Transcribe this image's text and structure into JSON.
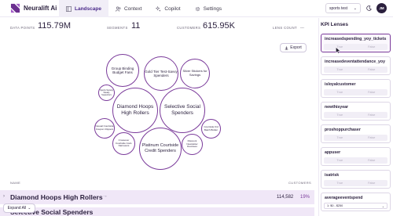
{
  "brand": {
    "name": "Neuralift Ai"
  },
  "nav": {
    "items": [
      {
        "label": "Landscape",
        "icon": "landscape-icon",
        "active": true
      },
      {
        "label": "Context",
        "icon": "people-icon",
        "active": false
      },
      {
        "label": "Copilot",
        "icon": "copilot-sparkle-icon",
        "active": false
      },
      {
        "label": "Settings",
        "icon": "gear-icon",
        "active": false
      }
    ]
  },
  "header": {
    "tenant": "sports test",
    "avatar_initials": "JM"
  },
  "stats": {
    "data_points_label": "DATA POINTS",
    "data_points_value": "115.79M",
    "segments_label": "SEGMENTS",
    "segments_value": "11",
    "customers_label": "CUSTOMERS",
    "customers_value": "615.95K",
    "lens_count_label": "LENS COUNT",
    "lens_count_value": "---"
  },
  "toolbar": {
    "export_label": "Export"
  },
  "segments": [
    {
      "label": "Group Binding Budget Fans"
    },
    {
      "label": "Gold Tier Test-Savvy Spenders"
    },
    {
      "label": "Silver Stickers for Savings"
    },
    {
      "label": "Sports Society Steady Supporters"
    },
    {
      "label": "Diamond Hoops High Rollers"
    },
    {
      "label": "Selective Social Spenders"
    },
    {
      "label": "Casual Courtside Coupon Clippers"
    },
    {
      "label": "Crossover Courtside Cord-Narrowers"
    },
    {
      "label": "Platinum Courtside Credit Spenders"
    },
    {
      "label": "Discount Newsletter Devotees"
    },
    {
      "label": "Courtside Kid Batch Bidder"
    }
  ],
  "table": {
    "col_name": "NAME",
    "col_customers": "CUSTOMERS",
    "rows": [
      {
        "name": "Diamond Hoops High Rollers",
        "customers": "114,582",
        "percent": "19%"
      },
      {
        "name": "Selective Social Spenders",
        "customers": "",
        "percent": ""
      }
    ],
    "expand_label": "Expand All"
  },
  "kpi": {
    "title": "KPI Lenses",
    "true_label": "True",
    "false_label": "False",
    "lenses": [
      {
        "name": "increasedspending_yoy_tickets",
        "kind": "boolean",
        "selected": true
      },
      {
        "name": "increasedeventattendance_yoy",
        "kind": "boolean",
        "selected": false
      },
      {
        "name": "isloyalcustomer",
        "kind": "boolean",
        "selected": false
      },
      {
        "name": "newthisyear",
        "kind": "boolean",
        "selected": false
      },
      {
        "name": "proshoppurchaser",
        "kind": "boolean",
        "selected": false
      },
      {
        "name": "appuser",
        "kind": "boolean",
        "selected": false
      },
      {
        "name": "isatrisk",
        "kind": "boolean",
        "selected": false
      },
      {
        "name": "averageeventspend",
        "kind": "range",
        "value": "1: $0 - $250",
        "selected": false
      }
    ]
  },
  "colors": {
    "accent": "#7a3a9a",
    "brand_dark": "#2a1f3d",
    "row_highlight": "#f0e7f7"
  }
}
